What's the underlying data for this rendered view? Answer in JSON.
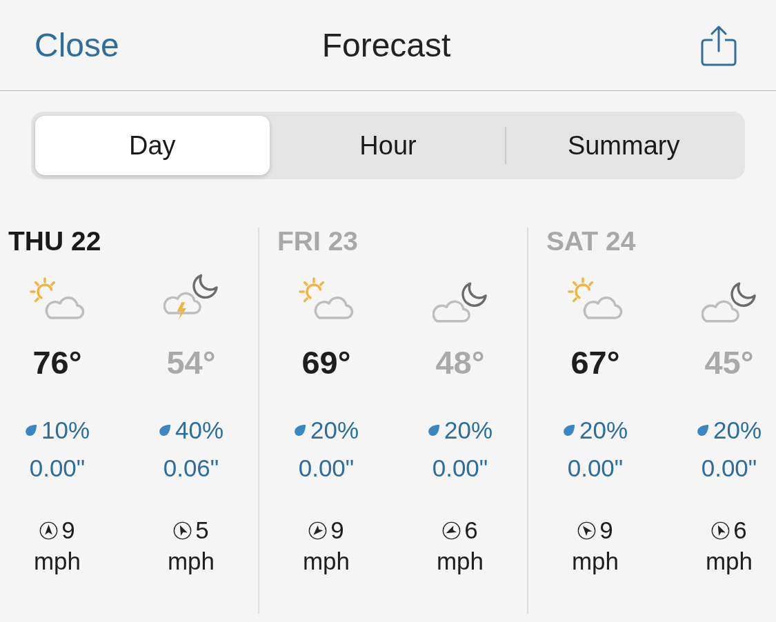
{
  "header": {
    "close": "Close",
    "title": "Forecast"
  },
  "tabs": [
    {
      "label": "Day",
      "selected": true
    },
    {
      "label": "Hour",
      "selected": false
    },
    {
      "label": "Summary",
      "selected": false
    }
  ],
  "days": [
    {
      "label": "THU 22",
      "selected": true,
      "periods": [
        {
          "kind": "day",
          "temp": "76°",
          "chance": "10%",
          "amount": "0.00\"",
          "wind_speed": "9",
          "wind_unit": "mph"
        },
        {
          "kind": "storm",
          "temp": "54°",
          "chance": "40%",
          "amount": "0.06\"",
          "wind_speed": "5",
          "wind_unit": "mph"
        }
      ]
    },
    {
      "label": "FRI 23",
      "selected": false,
      "periods": [
        {
          "kind": "day",
          "temp": "69°",
          "chance": "20%",
          "amount": "0.00\"",
          "wind_speed": "9",
          "wind_unit": "mph"
        },
        {
          "kind": "night",
          "temp": "48°",
          "chance": "20%",
          "amount": "0.00\"",
          "wind_speed": "6",
          "wind_unit": "mph"
        }
      ]
    },
    {
      "label": "SAT 24",
      "selected": false,
      "periods": [
        {
          "kind": "day",
          "temp": "67°",
          "chance": "20%",
          "amount": "0.00\"",
          "wind_speed": "9",
          "wind_unit": "mph"
        },
        {
          "kind": "night",
          "temp": "45°",
          "chance": "20%",
          "amount": "0.00\"",
          "wind_speed": "6",
          "wind_unit": "mph"
        }
      ]
    }
  ]
}
